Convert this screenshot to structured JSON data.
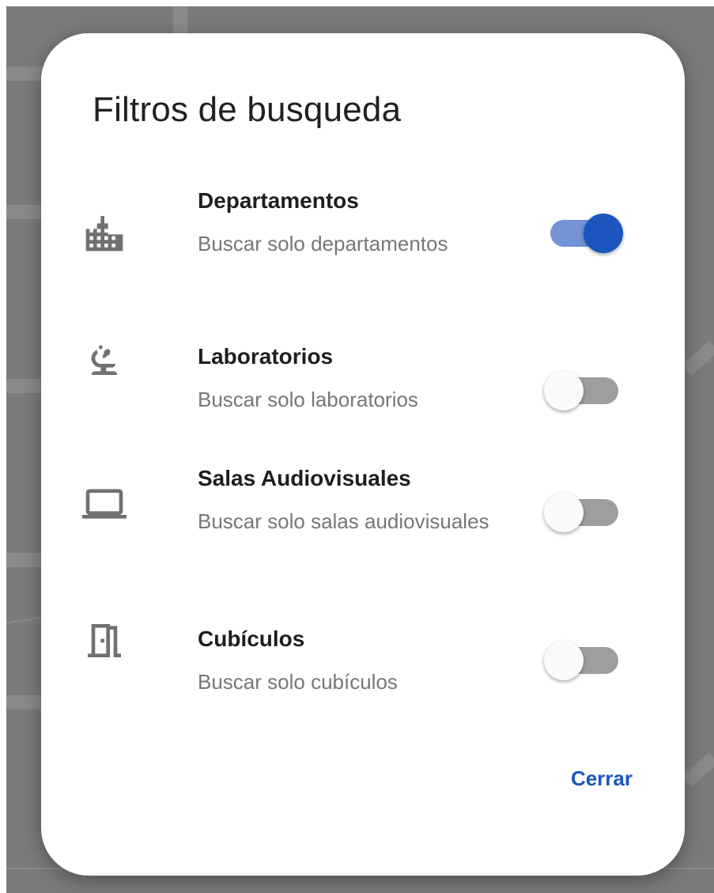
{
  "dialog": {
    "title": "Filtros de busqueda",
    "close_label": "Cerrar"
  },
  "filters": [
    {
      "icon": "building-icon",
      "label": "Departamentos",
      "description": "Buscar solo departamentos",
      "enabled": true
    },
    {
      "icon": "microscope-icon",
      "label": "Laboratorios",
      "description": "Buscar solo laboratorios",
      "enabled": false
    },
    {
      "icon": "laptop-icon",
      "label": "Salas Audiovisuales",
      "description": "Buscar solo salas audiovisuales",
      "enabled": false
    },
    {
      "icon": "door-icon",
      "label": "Cubículos",
      "description": "Buscar solo cubículos",
      "enabled": false
    }
  ],
  "colors": {
    "accent": "#1a56bd",
    "accent_track": "#7393d6",
    "off_track": "#9e9e9e",
    "icon": "#707070",
    "scrim": "#7b7b79"
  }
}
